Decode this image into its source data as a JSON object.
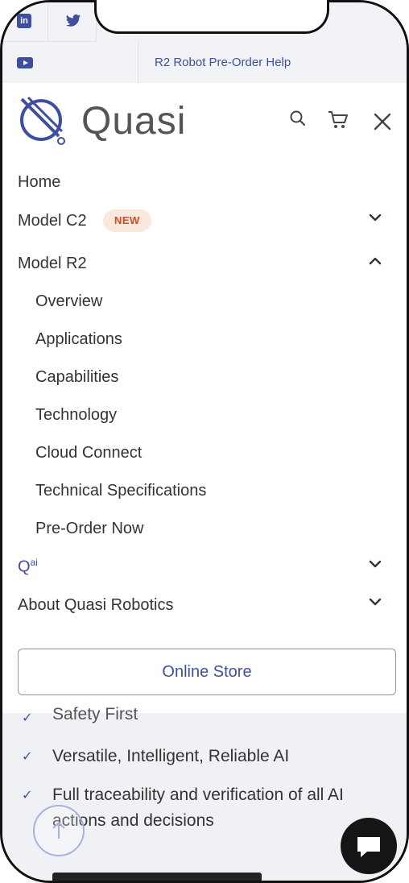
{
  "topbar": {
    "help_link": "R2 Robot Pre-Order Help",
    "linkedin_icon_text": "in"
  },
  "header": {
    "logo_text": "Quasi"
  },
  "menu": {
    "home": "Home",
    "model_c2": "Model C2",
    "new_badge": "NEW",
    "model_r2": "Model R2",
    "r2_sub": [
      "Overview",
      "Applications",
      "Capabilities",
      "Technology",
      "Cloud Connect",
      "Technical Specifications",
      "Pre-Order Now"
    ],
    "qai_main": "Q",
    "qai_sup": "ai",
    "about": "About Quasi Robotics",
    "online_store": "Online Store"
  },
  "content": {
    "items": [
      "Safety First",
      "Versatile, Intelligent, Reliable AI",
      "Full traceability and verification of all AI actions and decisions"
    ],
    "check_glyph": "✓"
  },
  "colors": {
    "brand": "#3f4f9f",
    "badge_bg": "#fbe8dc",
    "badge_text": "#d44a1e"
  }
}
